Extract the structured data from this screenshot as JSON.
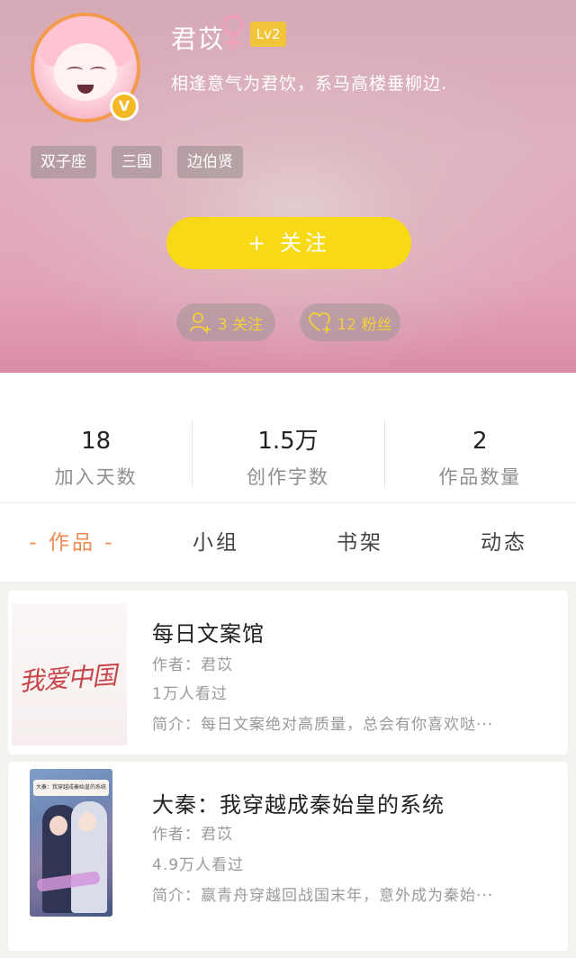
{
  "profile": {
    "username": "君苡",
    "level": "Lv2",
    "vip_badge": "V",
    "signature": "相逢意气为君饮，系马高楼垂柳边.",
    "tags": [
      "双子座",
      "三国",
      "边伯贤"
    ],
    "follow_button": "+ 关注",
    "following_text": "3 关注",
    "fans_text": "12 粉丝"
  },
  "stats": [
    {
      "value": "18",
      "label": "加入天数"
    },
    {
      "value": "1.5万",
      "label": "创作字数"
    },
    {
      "value": "2",
      "label": "作品数量"
    }
  ],
  "tabs": [
    {
      "label": "- 作品 -",
      "active": true
    },
    {
      "label": "小组",
      "active": false
    },
    {
      "label": "书架",
      "active": false
    },
    {
      "label": "动态",
      "active": false
    }
  ],
  "works": [
    {
      "cover_text": "我爱中国",
      "title": "每日文案馆",
      "author": "作者：君苡",
      "views": "1万人看过",
      "intro": "简介：每日文案绝对高质量，总会有你喜欢哒···"
    },
    {
      "cover_text": "大秦：我穿越成秦始皇的系统",
      "title": "大秦：我穿越成秦始皇的系统",
      "author": "作者：君苡",
      "views": "4.9万人看过",
      "intro": "简介：嬴青舟穿越回战国末年，意外成为秦始···"
    }
  ],
  "colors": {
    "accent": "#f08a53",
    "follow_button": "#f7d916",
    "level_badge": "#f1c43a",
    "header_pink": "#e3a4b8"
  }
}
